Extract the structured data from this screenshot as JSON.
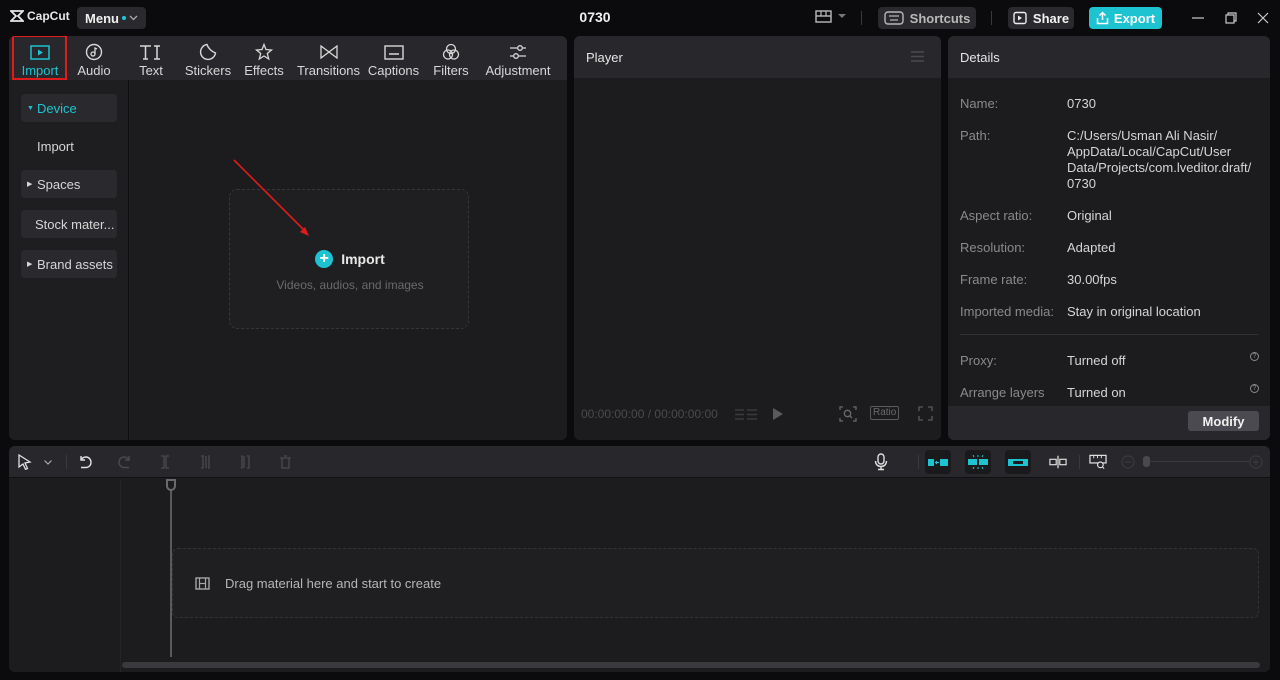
{
  "app": {
    "name": "CapCut",
    "menu_label": "Menu",
    "project_title": "0730",
    "shortcuts_label": "Shortcuts",
    "share_label": "Share",
    "export_label": "Export",
    "accent_color": "#1ec3d1"
  },
  "media": {
    "tabs": [
      {
        "label": "Import",
        "icon": "import-icon",
        "active": true
      },
      {
        "label": "Audio",
        "icon": "audio-icon"
      },
      {
        "label": "Text",
        "icon": "text-icon"
      },
      {
        "label": "Stickers",
        "icon": "stickers-icon"
      },
      {
        "label": "Effects",
        "icon": "effects-icon"
      },
      {
        "label": "Transitions",
        "icon": "transitions-icon"
      },
      {
        "label": "Captions",
        "icon": "captions-icon"
      },
      {
        "label": "Filters",
        "icon": "filters-icon"
      },
      {
        "label": "Adjustment",
        "icon": "adjustment-icon"
      }
    ],
    "side_nav": [
      {
        "label": "Device",
        "expanded": true,
        "active": true
      },
      {
        "label": "Import",
        "child": true
      },
      {
        "label": "Spaces",
        "expanded": false
      },
      {
        "label": "Stock mater...",
        "expanded": null
      },
      {
        "label": "Brand assets",
        "expanded": false
      }
    ],
    "dropzone": {
      "title": "Import",
      "subtitle": "Videos, audios, and images"
    }
  },
  "player": {
    "title": "Player",
    "timecode_current": "00:00:00:00",
    "timecode_total": "00:00:00:00",
    "ratio_label": "Ratio"
  },
  "details": {
    "title": "Details",
    "rows": [
      {
        "label": "Name:",
        "value": "0730"
      },
      {
        "label": "Path:",
        "value": "C:/Users/Usman Ali Nasir/ AppData/Local/CapCut/User Data/Projects/com.lveditor.draft/ 0730"
      },
      {
        "label": "Aspect ratio:",
        "value": "Original"
      },
      {
        "label": "Resolution:",
        "value": "Adapted"
      },
      {
        "label": "Frame rate:",
        "value": "30.00fps"
      },
      {
        "label": "Imported media:",
        "value": "Stay in original location"
      },
      {
        "label": "Proxy:",
        "value": "Turned off"
      },
      {
        "label": "Arrange layers",
        "value": "Turned on"
      }
    ],
    "modify_label": "Modify"
  },
  "timeline": {
    "drop_hint": "Drag material here and start to create"
  }
}
